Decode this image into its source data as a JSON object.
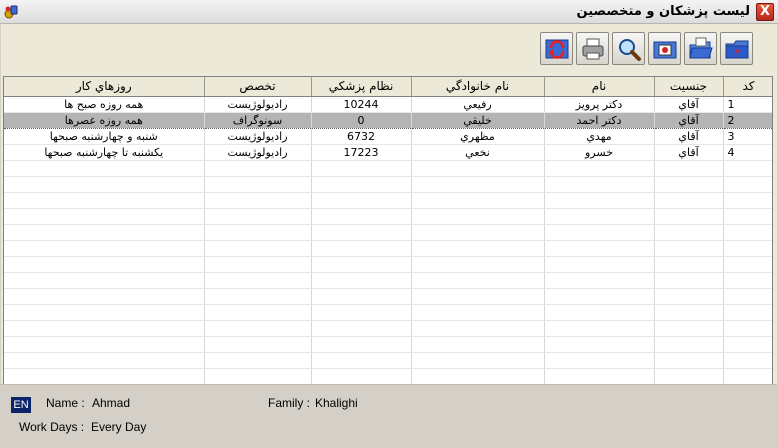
{
  "window": {
    "title": "ليست پزشكان و متخصصين",
    "close_label": "X"
  },
  "toolbar": {
    "buttons": [
      {
        "icon": "new-star-icon"
      },
      {
        "icon": "open-folder-icon"
      },
      {
        "icon": "record-icon"
      },
      {
        "icon": "search-icon"
      },
      {
        "icon": "print-icon"
      },
      {
        "icon": "refresh-icon"
      }
    ]
  },
  "table": {
    "columns": [
      "كد",
      "جنسيت",
      "نام",
      "نام خانوادگي",
      "نظام پزشكي",
      "تخصص",
      "روزهاي كار"
    ],
    "rows": [
      {
        "code": "1",
        "gender": "آقاي",
        "name": "دكتر پرويز",
        "family": "رفيعي",
        "med_no": "10244",
        "specialty": "راديولوژيست",
        "work_days": "همه روزه صبح ها"
      },
      {
        "code": "2",
        "gender": "آقاي",
        "name": "دكتر احمد",
        "family": "خليقي",
        "med_no": "0",
        "specialty": "سونوگراف",
        "work_days": "همه روزه عصرها"
      },
      {
        "code": "3",
        "gender": "آقاي",
        "name": "مهدي",
        "family": "مظهري",
        "med_no": "6732",
        "specialty": "راديولوژيست",
        "work_days": "شنبه و چهارشنبه صبحها"
      },
      {
        "code": "4",
        "gender": "آقاي",
        "name": "خسرو",
        "family": "نخعي",
        "med_no": "17223",
        "specialty": "راديولوژيست",
        "work_days": "يكشنبه تا چهارشنبه صبحها"
      }
    ],
    "selected_row": 2
  },
  "info": {
    "lang_badge": "EN",
    "name_label": "Name :",
    "name_value": "Ahmad",
    "family_label": "Family :",
    "family_value": "Khalighi",
    "workdays_label": "Work Days :",
    "workdays_value": "Every Day"
  },
  "colors": {
    "selected_row_bg": "#b4b4b4",
    "lang_badge_bg": "#0a246a",
    "close_button": "#c8321e"
  }
}
